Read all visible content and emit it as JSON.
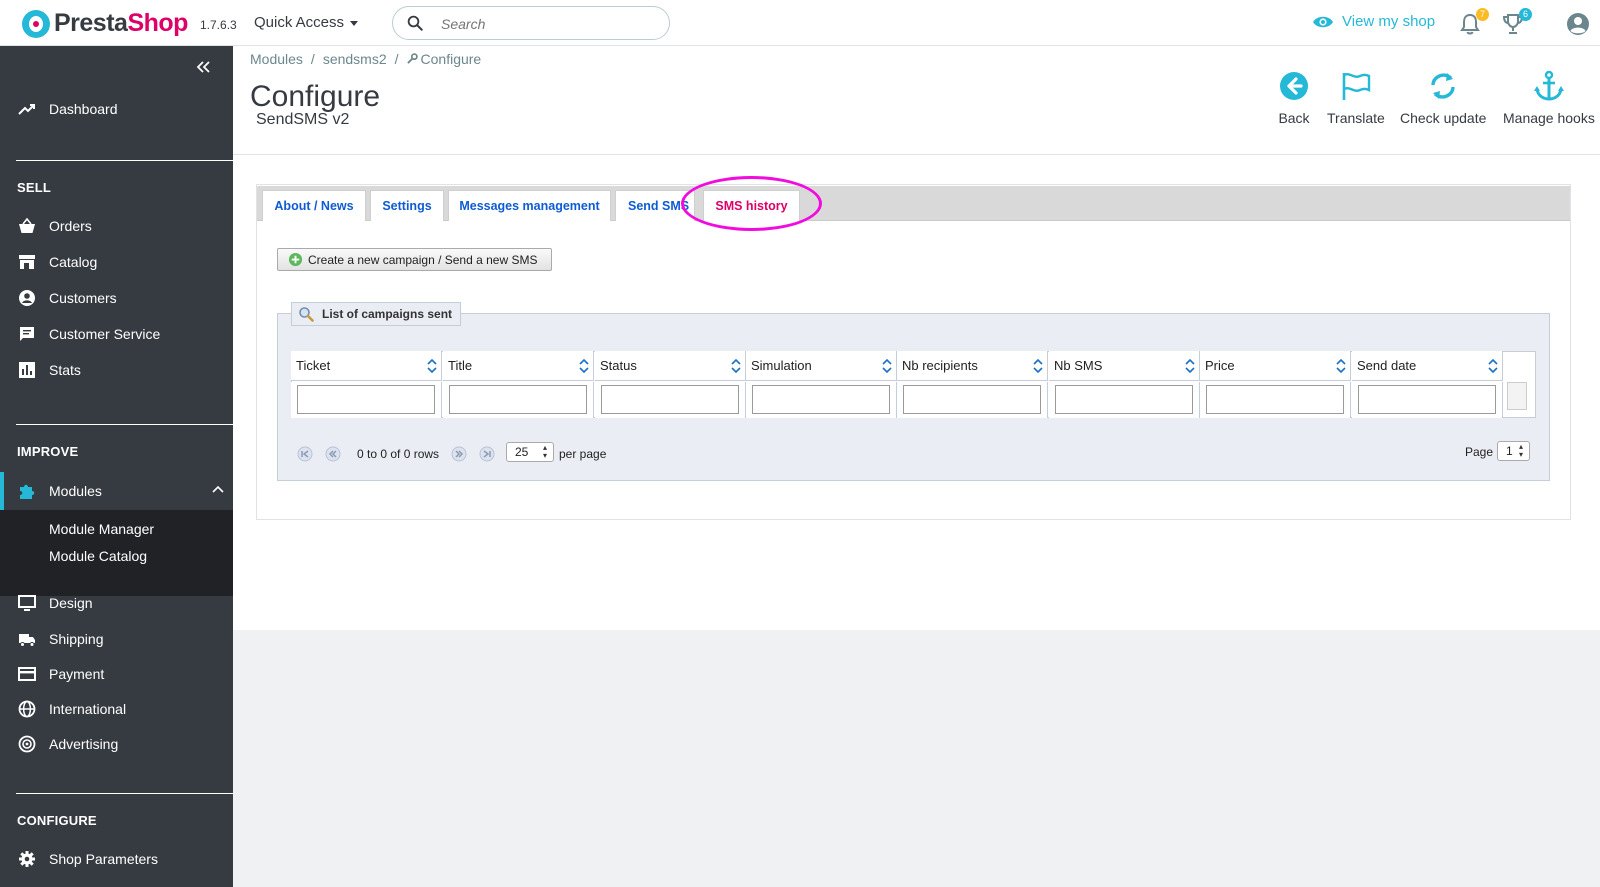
{
  "header": {
    "logo_presta": "Presta",
    "logo_shop": "Shop",
    "version": "1.7.6.3",
    "quick_access": "Quick Access",
    "search_placeholder": "Search",
    "view_shop": "View my shop",
    "notifications_count": "7",
    "orders_count": "6",
    "colors": {
      "accent": "#25b9d7",
      "brand": "#df0067",
      "badge_orange": "#fbbb22"
    }
  },
  "sidebar": {
    "dashboard": "Dashboard",
    "sell_title": "SELL",
    "sell_items": [
      "Orders",
      "Catalog",
      "Customers",
      "Customer Service",
      "Stats"
    ],
    "improve_title": "IMPROVE",
    "modules": "Modules",
    "module_sub": [
      "Module Manager",
      "Module Catalog"
    ],
    "improve_items": [
      "Design",
      "Shipping",
      "Payment",
      "International",
      "Advertising"
    ],
    "configure_title": "CONFIGURE",
    "shop_parameters": "Shop Parameters"
  },
  "breadcrumb": {
    "modules": "Modules",
    "sendsms2": "sendsms2",
    "configure": "Configure",
    "separator": "/"
  },
  "page": {
    "title": "Configure",
    "subtitle": "SendSMS v2"
  },
  "toolbar": {
    "back": "Back",
    "translate": "Translate",
    "check_update": "Check update",
    "manage_hooks": "Manage hooks"
  },
  "tabs": [
    "About / News",
    "Settings",
    "Messages management",
    "Send SMS",
    "SMS history"
  ],
  "active_tab": "SMS history",
  "create_button": "Create a new campaign / Send a new SMS",
  "campaigns": {
    "legend": "List of campaigns sent",
    "columns": [
      "Ticket",
      "Title",
      "Status",
      "Simulation",
      "Nb recipients",
      "Nb SMS",
      "Price",
      "Send date"
    ],
    "rows_info": "0 to 0 of 0 rows",
    "per_page_value": "25",
    "per_page_label": "per page",
    "page_label": "Page",
    "page_value": "1"
  }
}
